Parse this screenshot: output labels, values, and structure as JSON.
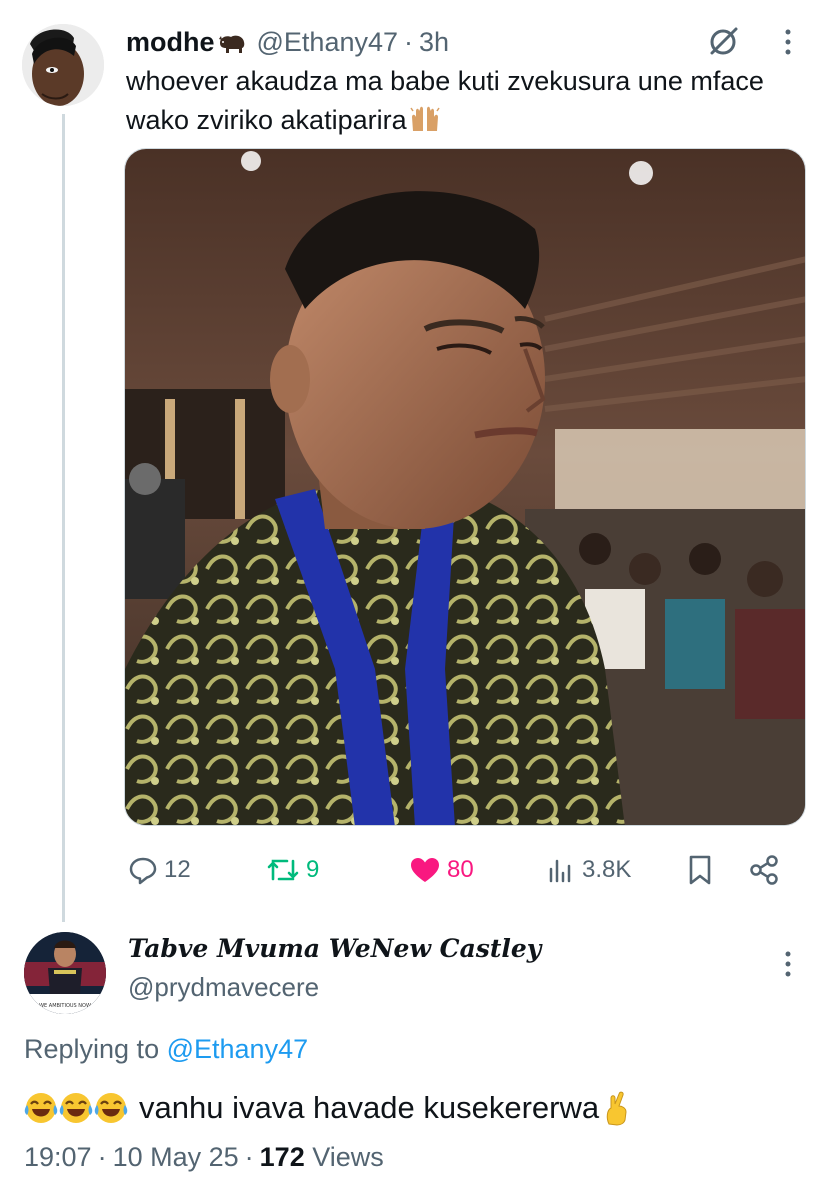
{
  "parent_tweet": {
    "author_name": "modhe",
    "author_name_emoji": "bison-emoji",
    "handle": "@Ethany47",
    "separator": "·",
    "time": "3h",
    "text": "whoever akaudza ma babe kuti zvekusura une mface wako zviriko akatiparira",
    "text_emoji": "raising-hands-emoji",
    "media_description_icon": "photo",
    "actions": {
      "replies": "12",
      "retweets": "9",
      "likes": "80",
      "views": "3.8K"
    }
  },
  "reply_tweet": {
    "author_name": "Tabve Mvuma WeNew Castley",
    "handle": "@prydmavecere",
    "replying_prefix": "Replying to",
    "replying_to": "@Ethany47",
    "text": "vanhu ivava havade kusekererwa",
    "leading_emojis": [
      "face-with-tears-of-joy",
      "face-with-tears-of-joy",
      "face-with-tears-of-joy"
    ],
    "trailing_emoji": "crossed-fingers",
    "time": "19:07",
    "date": "10 May 25",
    "separator": "·",
    "views_count": "172",
    "views_label": "Views",
    "avatar_banner_text": "WE AMBITIOUS NOW"
  },
  "colors": {
    "text": "#0f1419",
    "secondary": "#536471",
    "link": "#1d9bf0",
    "retweet": "#00ba7c",
    "like": "#f91880",
    "thread_line": "#cfd9de"
  }
}
